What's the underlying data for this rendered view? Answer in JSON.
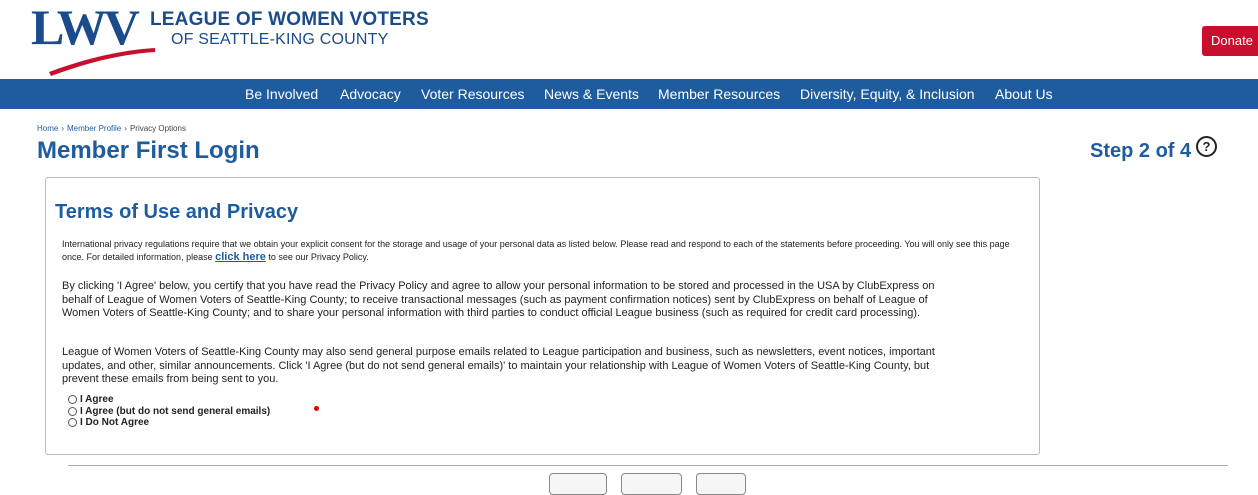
{
  "header": {
    "logo_mark": "LWV",
    "logo_line1": "LEAGUE OF WOMEN VOTERS",
    "logo_line2": "OF SEATTLE-KING COUNTY",
    "donate_label": "Donate"
  },
  "nav": {
    "items": [
      {
        "label": "Be Involved"
      },
      {
        "label": "Advocacy"
      },
      {
        "label": "Voter Resources"
      },
      {
        "label": "News & Events"
      },
      {
        "label": "Member Resources"
      },
      {
        "label": "Diversity, Equity, & Inclusion"
      },
      {
        "label": "About Us"
      }
    ]
  },
  "breadcrumb": {
    "items": [
      "Home",
      "Member Profile",
      "Privacy Options"
    ],
    "separator": "›"
  },
  "page": {
    "title": "Member First Login",
    "step": "Step 2 of 4",
    "help_glyph": "?"
  },
  "terms": {
    "title": "Terms of Use and Privacy",
    "intro_before": "International privacy regulations require that we obtain your explicit consent for the storage and usage of your personal data as listed below. Please read and respond to each of the statements before proceeding. You will only see this page once. For detailed information, please ",
    "intro_link": "click here",
    "intro_after": " to see our Privacy Policy.",
    "paragraph1": "By clicking 'I Agree' below, you certify that you have read the Privacy Policy and agree to allow your personal information to be stored and processed in the USA by ClubExpress on behalf of League of Women Voters of Seattle-King County; to receive transactional messages (such as payment confirmation notices) sent by ClubExpress on behalf of League of Women Voters of Seattle-King County; and to share your personal information with third parties to conduct official League business (such as required for credit card processing).",
    "paragraph2": "League of Women Voters of Seattle-King County may also send general purpose emails related to League participation and business, such as newsletters, event notices, important updates, and other, similar announcements. Click 'I Agree (but do not send general emails)' to maintain your relationship with League of Women Voters of Seattle-King County, but prevent these emails from being sent to you.",
    "options": [
      {
        "label": "I Agree",
        "selected": false
      },
      {
        "label": "I Agree (but do not send general emails)",
        "selected": false
      },
      {
        "label": "I Do Not Agree",
        "selected": false
      }
    ]
  },
  "colors": {
    "brand_blue": "#1f5c9e",
    "donate_red": "#c8102e"
  }
}
